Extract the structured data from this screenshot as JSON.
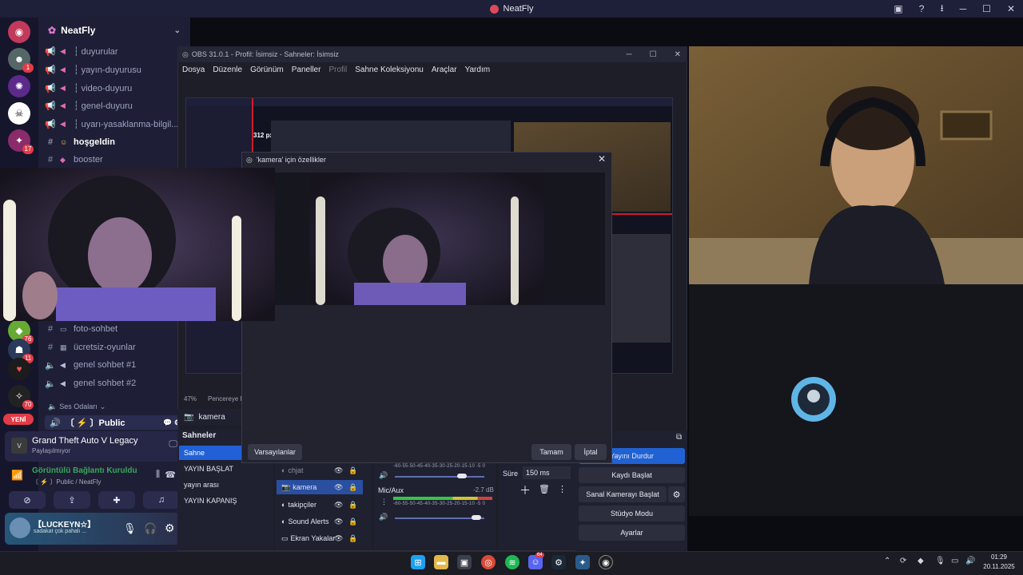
{
  "discord_window": {
    "title": "NeatFly",
    "server_name": "NeatFly",
    "channels": [
      {
        "name": "┆ duyurular"
      },
      {
        "name": "┆ yayın-duyurusu"
      },
      {
        "name": "┆ video-duyuru"
      },
      {
        "name": "┆ genel-duyuru"
      },
      {
        "name": "┆ uyarı-yasaklanma-bilgil..."
      },
      {
        "name": "hoşgeldin"
      },
      {
        "name": "booster"
      },
      {
        "name": "foto-sohbet"
      },
      {
        "name": "ücretsiz-oyunlar"
      },
      {
        "name": "genel sohbet #1"
      },
      {
        "name": "genel sohbet #2"
      }
    ],
    "server_badges": [
      "1",
      "17",
      "76",
      "11",
      "70"
    ],
    "new_badge": "YENİ",
    "voice_category": "Ses Odaları",
    "voice_channel": "〔 ⚡ 〕Public",
    "game": {
      "title": "Grand Theft Auto V Legacy",
      "subtitle": "Paylaşılmıyor"
    },
    "voice_status": {
      "title": "Görüntülü Bağlantı Kuruldu",
      "subtitle": "〔 ⚡ 〕Public / NeatFly"
    },
    "user": {
      "name": "【LUCKEYN☆】",
      "status": "sadakat çok pahalı ..."
    }
  },
  "obs": {
    "title": "OBS 31.0.1 - Profil: İsimsiz - Sahneler: İsimsiz",
    "menu": [
      "Dosya",
      "Düzenle",
      "Görünüm",
      "Paneller",
      "Profil",
      "Sahne Koleksiyonu",
      "Araçlar",
      "Yardım"
    ],
    "zoom": "47%",
    "status_text": "Pencereye Bo",
    "nested_width_label": "312 px",
    "selected_source_label": "kamera",
    "scenes_title": "Sahneler",
    "scenes": [
      "Sahne",
      "YAYIN BAŞLAT",
      "yayın arası",
      "YAYIN KAPANIŞ"
    ],
    "sources": [
      "chjat",
      "kamera",
      "takipçiler",
      "Sound Alerts",
      "Ekran Yakalar"
    ],
    "mixer": {
      "scale": "-60-55-50-45-40-35-30-25-20-15-10 -5 0",
      "channel_name": "Mic/Aux",
      "channel_db": "-2.7 dB"
    },
    "transition": {
      "duration_label": "Süre",
      "duration_value": "150 ms"
    },
    "controls": [
      "Yayını Durdur",
      "Kaydı Başlat",
      "Sanal Kamerayı Başlat",
      "Stüdyo Modu",
      "Ayarlar"
    ]
  },
  "properties_dialog": {
    "title": "'kamera' için özellikler",
    "defaults_button": "Varsayılanlar",
    "ok_button": "Tamam",
    "cancel_button": "İptal"
  },
  "taskbar": {
    "time": "01:29",
    "date": "20.11.2025",
    "discord_badge": "64"
  },
  "colors": {
    "accent": "#2160d6",
    "discord_bg": "#1e1f36",
    "obs_bg": "#1d1e28"
  }
}
